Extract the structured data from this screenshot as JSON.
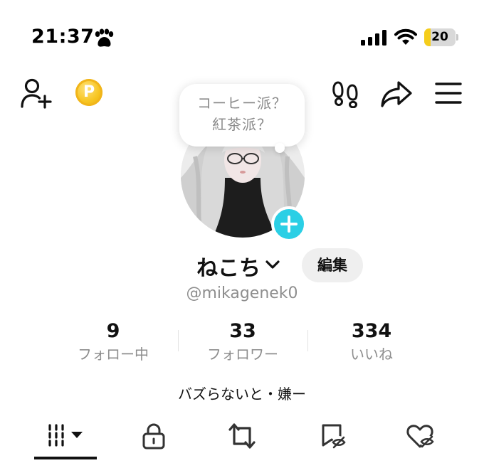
{
  "status_bar": {
    "time": "21:37",
    "status_icon": "paw-icon",
    "signal_icon": "cellular-signal-icon",
    "wifi_icon": "wifi-icon",
    "battery_level": "20",
    "battery_fraction": 0.2,
    "battery_color": "#f5cd1b"
  },
  "top_nav": {
    "left_icons": [
      "add-friend-icon",
      "coin-icon"
    ],
    "coin_letter": "P",
    "right_icons": [
      "footprint-icon",
      "share-icon",
      "menu-icon"
    ]
  },
  "profile": {
    "bubble_lines": [
      "コーヒー派？",
      "紅茶派？"
    ],
    "username": "ねこち",
    "edit_label": "編集",
    "handle": "@mikagenek0",
    "accent_color": "#2bcfe5"
  },
  "stats": [
    {
      "value": "9",
      "label": "フォロー中"
    },
    {
      "value": "33",
      "label": "フォロワー"
    },
    {
      "value": "334",
      "label": "いいね"
    }
  ],
  "bio": "バズらないと・嫌ー",
  "tabs": [
    {
      "icon": "videos-grid-icon",
      "active": true
    },
    {
      "icon": "lock-icon",
      "active": false
    },
    {
      "icon": "repost-icon",
      "active": false
    },
    {
      "icon": "bookmark-hidden-icon",
      "active": false
    },
    {
      "icon": "liked-hidden-icon",
      "active": false
    }
  ]
}
